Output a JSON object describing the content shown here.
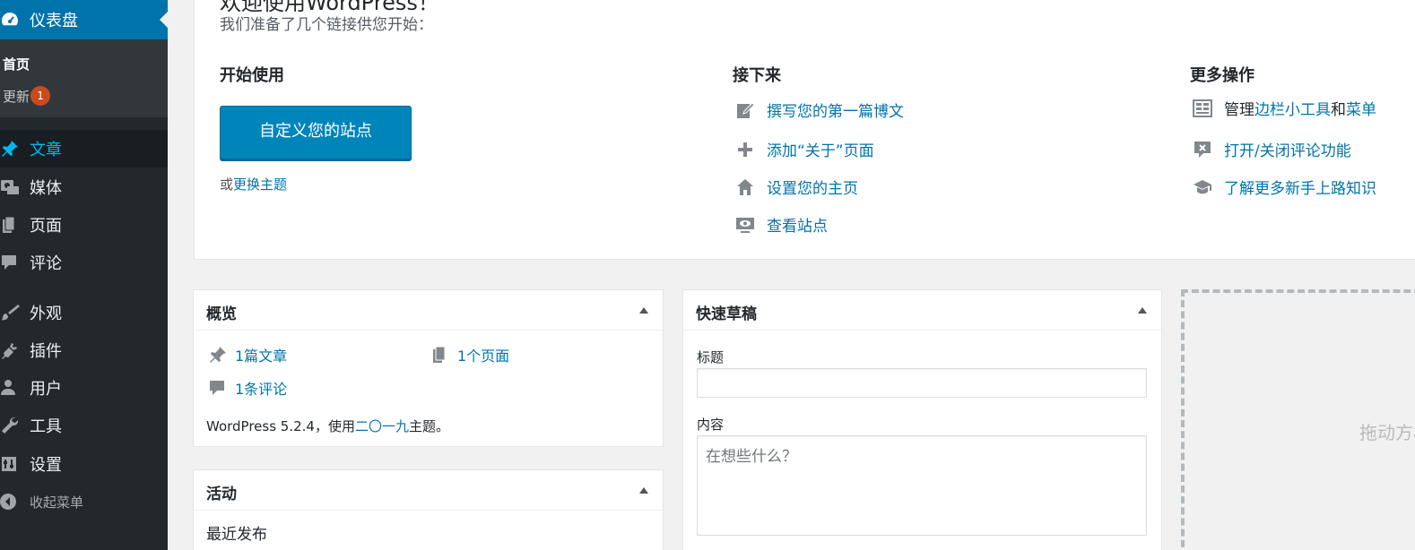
{
  "colors": {
    "sidebar_bg": "#23282d",
    "accent": "#0073aa",
    "button": "#0085ba",
    "badge": "#ca4a1f",
    "active_text": "#00b9eb"
  },
  "sidebar": {
    "dashboard": {
      "label": "仪表盘",
      "icon": "dashboard-icon"
    },
    "submenu": {
      "home": "首页",
      "updates": "更新",
      "updates_badge": "1"
    },
    "items": [
      {
        "label": "文章",
        "icon": "pin-icon"
      },
      {
        "label": "媒体",
        "icon": "media-icon"
      },
      {
        "label": "页面",
        "icon": "pages-icon"
      },
      {
        "label": "评论",
        "icon": "comment-icon"
      },
      {
        "label": "外观",
        "icon": "brush-icon"
      },
      {
        "label": "插件",
        "icon": "plugin-icon"
      },
      {
        "label": "用户",
        "icon": "user-icon"
      },
      {
        "label": "工具",
        "icon": "wrench-icon"
      },
      {
        "label": "设置",
        "icon": "settings-icon"
      }
    ],
    "collapse": "收起菜单"
  },
  "welcome": {
    "title": "欢迎使用WordPress！",
    "subtitle": "我们准备了几个链接供您开始：",
    "col1": {
      "heading": "开始使用",
      "button": "自定义您的站点",
      "or": "或",
      "theme_link": "更换主题"
    },
    "col2": {
      "heading": "接下来",
      "links": [
        "撰写您的第一篇博文",
        "添加“关于”页面",
        "设置您的主页",
        "查看站点"
      ]
    },
    "col3": {
      "heading": "更多操作",
      "manage": "管理",
      "widgets_link": "边栏小工具",
      "and": "和",
      "menus_link": "菜单",
      "comments_toggle": "打开/关闭评论功能",
      "learn": "了解更多新手上路知识"
    }
  },
  "glance": {
    "title": "概览",
    "posts": "1篇文章",
    "pages": "1个页面",
    "comments": "1条评论",
    "version_prefix": "WordPress 5.2.4，使用",
    "theme": "二〇一九",
    "version_suffix": "主题。"
  },
  "activity": {
    "title": "活动",
    "recent": "最近发布"
  },
  "draft": {
    "title": "快速草稿",
    "title_label": "标题",
    "content_label": "内容",
    "content_placeholder": "在想些什么？"
  },
  "dropzone": {
    "text": "拖动方框到这里"
  }
}
